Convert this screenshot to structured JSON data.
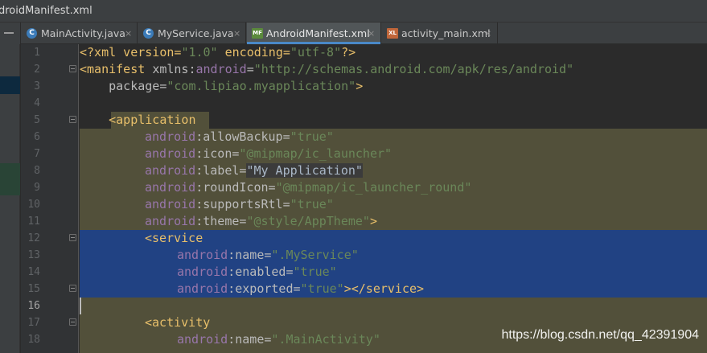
{
  "window": {
    "title": "droidManifest.xml"
  },
  "tabs": [
    {
      "label": "MainActivity.java",
      "icon": "java-class-icon",
      "active": false
    },
    {
      "label": "MyService.java",
      "icon": "java-class-icon",
      "active": false
    },
    {
      "label": "AndroidManifest.xml",
      "icon": "manifest-xml-icon",
      "active": true
    },
    {
      "label": "activity_main.xml",
      "icon": "layout-xml-icon",
      "active": false
    }
  ],
  "tab_close_glyph": "×",
  "icon_glyphs": {
    "java": "C",
    "manifest": "MF",
    "layout": "XL"
  },
  "line_numbers": [
    "1",
    "2",
    "3",
    "4",
    "5",
    "6",
    "7",
    "8",
    "9",
    "10",
    "11",
    "12",
    "13",
    "14",
    "15",
    "16",
    "17",
    "18"
  ],
  "current_line": "16",
  "code": {
    "l1": {
      "a": "<?xml version=",
      "b": "\"1.0\"",
      "c": " encoding=",
      "d": "\"utf-8\"",
      "e": "?>"
    },
    "l2": {
      "a": "<manifest ",
      "b": "xmlns:",
      "c": "android",
      "d": "=",
      "e": "\"http://schemas.android.com/apk/res/android\""
    },
    "l3": {
      "a": "    package=",
      "b": "\"com.lipiao.myapplication\"",
      "c": ">"
    },
    "l5": {
      "a": "    <application"
    },
    "l6": {
      "ns": "android",
      "attr": ":allowBackup=",
      "val": "\"true\""
    },
    "l7": {
      "ns": "android",
      "attr": ":icon=",
      "val": "\"@mipmap/ic_launcher\""
    },
    "l8": {
      "ns": "android",
      "attr": ":label=",
      "val": "\"My Application\""
    },
    "l9": {
      "ns": "android",
      "attr": ":roundIcon=",
      "val": "\"@mipmap/ic_launcher_round\""
    },
    "l10": {
      "ns": "android",
      "attr": ":supportsRtl=",
      "val": "\"true\""
    },
    "l11": {
      "ns": "android",
      "attr": ":theme=",
      "val": "\"@style/AppTheme\"",
      "end": ">"
    },
    "l12": {
      "tag": "<service"
    },
    "l13": {
      "ns": "android",
      "attr": ":name=",
      "val": "\".MyService\""
    },
    "l14": {
      "ns": "android",
      "attr": ":enabled=",
      "val": "\"true\""
    },
    "l15": {
      "ns": "android",
      "attr": ":exported=",
      "val": "\"true\"",
      "end": "></service>"
    },
    "l17": {
      "tag": "<activity"
    },
    "l18": {
      "ns": "android",
      "attr": ":name=",
      "val": "\".MainActivity\""
    }
  },
  "colors": {
    "scope_highlight": "#52503a",
    "selection": "#214283",
    "tag": "#e8bf6a",
    "namespace": "#9876aa",
    "value": "#6a8759",
    "accent": "#4a88c7"
  },
  "watermark": "https://blog.csdn.net/qq_42391904"
}
